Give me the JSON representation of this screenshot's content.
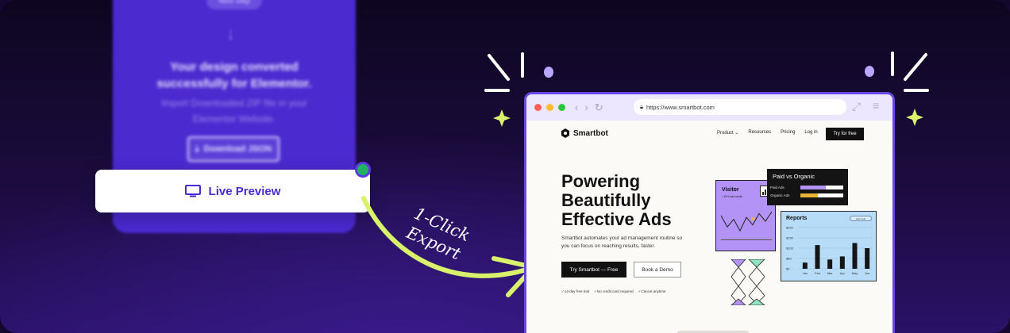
{
  "left_panel": {
    "next_step_label": "Next Step",
    "headline": "Your design converted successfully for Elementor.",
    "instructions": "Import Downloaded ZIP file in your Elementor Website.",
    "download_button_label": "Download JSON"
  },
  "live_preview": {
    "label": "Live Preview",
    "icon": "monitor-icon",
    "status_color": "#23b360"
  },
  "export_annotation": {
    "line1": "1-Click",
    "line2": "Export",
    "arrow_color": "#d9f26b"
  },
  "browser": {
    "url": "https://www.smartbot.com",
    "site": {
      "brand": "Smartbot",
      "nav": [
        "Product ⌄",
        "Resources",
        "Pricing",
        "Log in"
      ],
      "cta": "Try for free",
      "hero_title_lines": [
        "Powering",
        "Beautifully",
        "Effective Ads"
      ],
      "hero_subtitle": "Smartbot automates your ad management routine so you can focus on reaching results, faster.",
      "primary_button": "Try Smartbot — Free",
      "secondary_button": "Book a Demo",
      "checks": [
        "✓14-day free trial",
        "✓No credit card required",
        "✓Cancel anytime"
      ],
      "visitor_card": {
        "title": "Visitor",
        "subtitle": "• 10% last month",
        "trend": [
          10,
          4,
          8,
          2,
          9,
          5,
          11,
          7,
          12
        ]
      },
      "paid_card": {
        "title": "Paid vs Organic",
        "rows": [
          {
            "label": "Paid Ads",
            "value": 0.6
          },
          {
            "label": "Organic Ads",
            "value": 0.4
          }
        ]
      },
      "reports_card": {
        "title": "Reports",
        "filter": "Last Year",
        "y_ticks": [
          "$200",
          "$150",
          "$100",
          "$50",
          "$0"
        ],
        "months": [
          "Jan",
          "Feb",
          "Mar",
          "Apr",
          "May",
          "Jun"
        ],
        "values": [
          30,
          115,
          45,
          60,
          125,
          100
        ]
      }
    }
  },
  "colors": {
    "accent_purple": "#6b46e6",
    "lime": "#d9f26b",
    "lavender_dot": "#b8a6ff"
  }
}
